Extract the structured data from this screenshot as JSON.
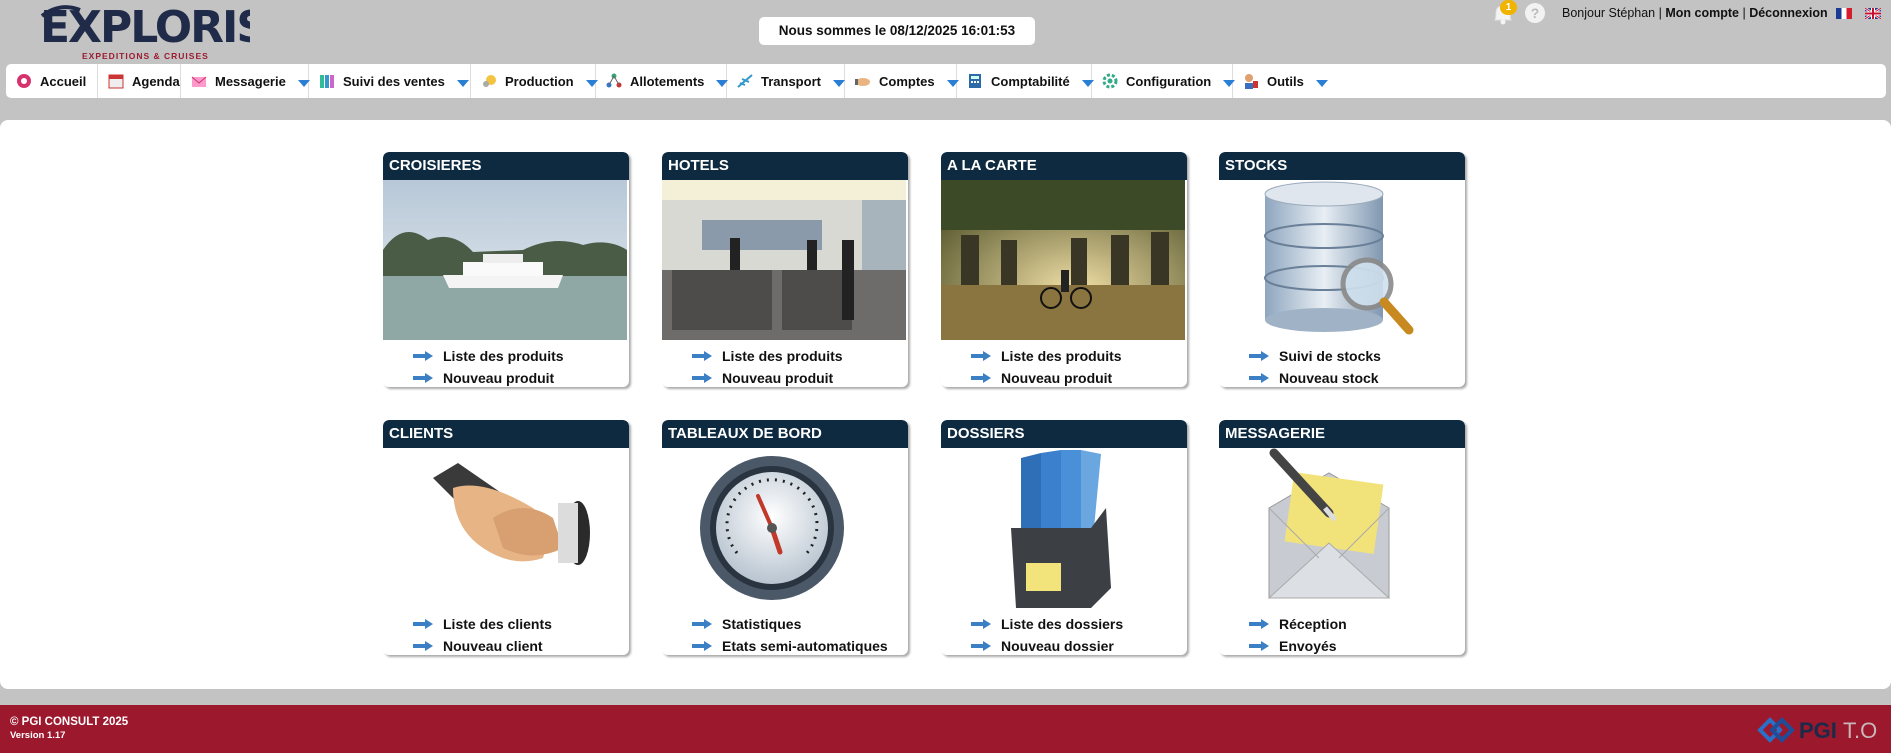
{
  "header": {
    "logo_text": "EXPLORIS",
    "logo_tagline": "EXPEDITIONS & CRUISES",
    "date_text": "Nous sommes le 08/12/2025 16:01:53",
    "notification_count": "1",
    "help_label": "?",
    "greeting": "Bonjour Stéphan",
    "account_link": "Mon compte",
    "separator": "|",
    "logout_link": "Déconnexion"
  },
  "menu": {
    "items": [
      {
        "label": "Accueil",
        "icon": "home-icon"
      },
      {
        "label": "Agenda",
        "icon": "calendar-icon"
      },
      {
        "label": "Messagerie",
        "icon": "mail-icon"
      },
      {
        "label": "Suivi des ventes",
        "icon": "sales-icon"
      },
      {
        "label": "Production",
        "icon": "production-icon"
      },
      {
        "label": "Allotements",
        "icon": "allotment-icon"
      },
      {
        "label": "Transport",
        "icon": "plane-icon"
      },
      {
        "label": "Comptes",
        "icon": "handshake-icon"
      },
      {
        "label": "Comptabilité",
        "icon": "calculator-icon"
      },
      {
        "label": "Configuration",
        "icon": "gear-icon"
      },
      {
        "label": "Outils",
        "icon": "tools-icon"
      }
    ]
  },
  "tiles": [
    {
      "title": "CROISIERES",
      "image": "cruise-ship-photo",
      "links": [
        "Liste des produits",
        "Nouveau produit"
      ]
    },
    {
      "title": "HOTELS",
      "image": "hotel-reception-photo",
      "links": [
        "Liste des produits",
        "Nouveau produit"
      ]
    },
    {
      "title": "A LA CARTE",
      "image": "temple-cyclist-photo",
      "links": [
        "Liste des produits",
        "Nouveau produit"
      ]
    },
    {
      "title": "STOCKS",
      "image": "database-magnifier-icon",
      "links": [
        "Suivi de stocks",
        "Nouveau stock"
      ]
    },
    {
      "title": "CLIENTS",
      "image": "handshake-icon",
      "links": [
        "Liste des clients",
        "Nouveau client"
      ]
    },
    {
      "title": "TABLEAUX DE BORD",
      "image": "speedometer-icon",
      "links": [
        "Statistiques",
        "Etats semi-automatiques"
      ]
    },
    {
      "title": "DOSSIERS",
      "image": "folders-icon",
      "links": [
        "Liste des dossiers",
        "Nouveau dossier"
      ]
    },
    {
      "title": "MESSAGERIE",
      "image": "envelope-pen-icon",
      "links": [
        "Réception",
        "Envoyés"
      ]
    }
  ],
  "footer": {
    "copyright": "© PGI CONSULT 2025",
    "version": "Version 1.17",
    "brand": "PGI",
    "brand_suffix": "T.O"
  },
  "colors": {
    "tile_header": "#0e2a40",
    "footer": "#9c182d",
    "caret": "#2a7fd4",
    "background": "#c3c3c3"
  }
}
